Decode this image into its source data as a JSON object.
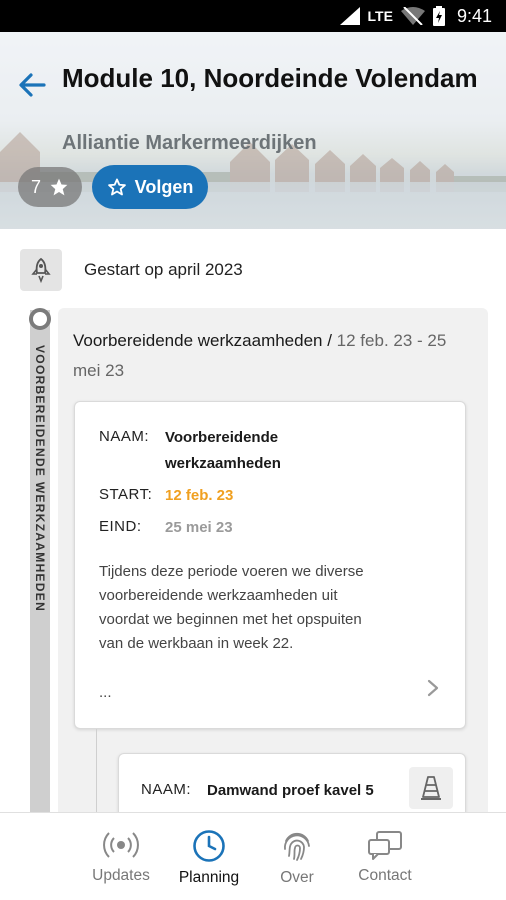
{
  "status_bar": {
    "network": "LTE",
    "time": "9:41"
  },
  "header": {
    "title": "Module 10, Noordeinde Volendam",
    "subtitle": "Alliantie Markermeerdijken",
    "favorite_count": "7",
    "follow_label": "Volgen",
    "accent_color": "#1b73b8"
  },
  "started": {
    "text": "Gestart op april 2023",
    "icon": "rocket-icon"
  },
  "phase": {
    "vertical_label": "VOORBEREIDENDE WERKZAAMHEDEN",
    "title": "Voorbereidende werkzaamheden /",
    "dates": " 12 feb. 23 - 25 mei 23"
  },
  "detail_card": {
    "name_label": "NAAM:",
    "name_value": "Voorbereidende werkzaamheden",
    "start_label": "START:",
    "start_value": "12 feb. 23",
    "end_label": "EIND:",
    "end_value": "25 mei 23",
    "description": "Tijdens deze periode voeren we diverse voorbereidende werkzaamheden uit voordat we beginnen met het opspuiten van de werkbaan in week 22.",
    "ellipsis": "...",
    "start_color": "#f0a020"
  },
  "sub_card": {
    "name_label": "NAAM:",
    "name_value": "Damwand proef kavel 5",
    "icon": "traffic-cone-icon"
  },
  "bottom_nav": {
    "items": [
      {
        "label": "Updates",
        "icon": "broadcast-icon"
      },
      {
        "label": "Planning",
        "icon": "clock-icon"
      },
      {
        "label": "Over",
        "icon": "fingerprint-icon"
      },
      {
        "label": "Contact",
        "icon": "chat-icon"
      }
    ],
    "active": "Planning"
  }
}
